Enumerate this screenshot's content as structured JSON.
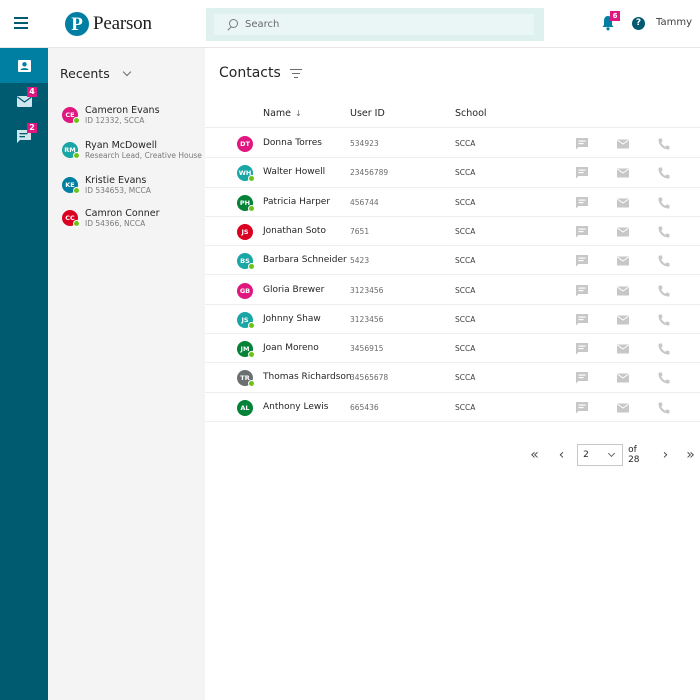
{
  "header": {
    "brand": "Pearson",
    "brand_initial": "P",
    "search_placeholder": "Search",
    "notifications_count": "6",
    "help_label": "?",
    "user_name": "Tammy"
  },
  "colors": {
    "brand_dark": "#005a70",
    "brand_accent": "#007fa3",
    "badge": "#e0177f",
    "presence": "#6ec319"
  },
  "rail": {
    "items": [
      {
        "name": "contacts",
        "icon": "contact-card-icon",
        "active": true,
        "badge": ""
      },
      {
        "name": "mail",
        "icon": "mail-icon",
        "active": false,
        "badge": "4"
      },
      {
        "name": "messages",
        "icon": "chat-icon",
        "active": false,
        "badge": "2"
      }
    ]
  },
  "recents": {
    "title": "Recents",
    "items": [
      {
        "initials": "CE",
        "name": "Cameron Evans",
        "sub": "ID 12332, SCCA",
        "color": "#e0177f",
        "online": true
      },
      {
        "initials": "RM",
        "name": "Ryan McDowell",
        "sub": "Research Lead, Creative House",
        "color": "#19a6a4",
        "online": true
      },
      {
        "initials": "KE",
        "name": "Kristie Evans",
        "sub": "ID 534653, MCCA",
        "color": "#007fa3",
        "online": true
      },
      {
        "initials": "CC",
        "name": "Camron Conner",
        "sub": "ID 54366, NCCA",
        "color": "#db0020",
        "online": true
      }
    ]
  },
  "contacts": {
    "title": "Contacts",
    "columns": {
      "name": "Name",
      "sort_indicator": "↓",
      "user_id": "User ID",
      "school": "School"
    },
    "rows": [
      {
        "initials": "DT",
        "name": "Donna Torres",
        "user_id": "534923",
        "school": "SCCA",
        "color": "#e0177f",
        "online": false
      },
      {
        "initials": "WH",
        "name": "Walter Howell",
        "user_id": "23456789",
        "school": "SCCA",
        "color": "#19a6a4",
        "online": true
      },
      {
        "initials": "PH",
        "name": "Patricia Harper",
        "user_id": "456744",
        "school": "SCCA",
        "color": "#038238",
        "online": true
      },
      {
        "initials": "JS",
        "name": "Jonathan Soto",
        "user_id": "7651",
        "school": "SCCA",
        "color": "#db0020",
        "online": false
      },
      {
        "initials": "BS",
        "name": "Barbara Schneider",
        "user_id": "5423",
        "school": "SCCA",
        "color": "#19a6a4",
        "online": true
      },
      {
        "initials": "GB",
        "name": "Gloria Brewer",
        "user_id": "3123456",
        "school": "SCCA",
        "color": "#e0177f",
        "online": false
      },
      {
        "initials": "JS",
        "name": "Johnny Shaw",
        "user_id": "3123456",
        "school": "SCCA",
        "color": "#19a6a4",
        "online": true
      },
      {
        "initials": "JM",
        "name": "Joan Moreno",
        "user_id": "3456915",
        "school": "SCCA",
        "color": "#038238",
        "online": true
      },
      {
        "initials": "TR",
        "name": "Thomas Richardson",
        "user_id": "34565678",
        "school": "SCCA",
        "color": "#6a7070",
        "online": true
      },
      {
        "initials": "AL",
        "name": "Anthony Lewis",
        "user_id": "665436",
        "school": "SCCA",
        "color": "#038238",
        "online": false
      }
    ]
  },
  "pagination": {
    "first": "«",
    "prev": "‹",
    "current_page": "2",
    "of_label": "of 28",
    "next": "›",
    "last": "»"
  }
}
